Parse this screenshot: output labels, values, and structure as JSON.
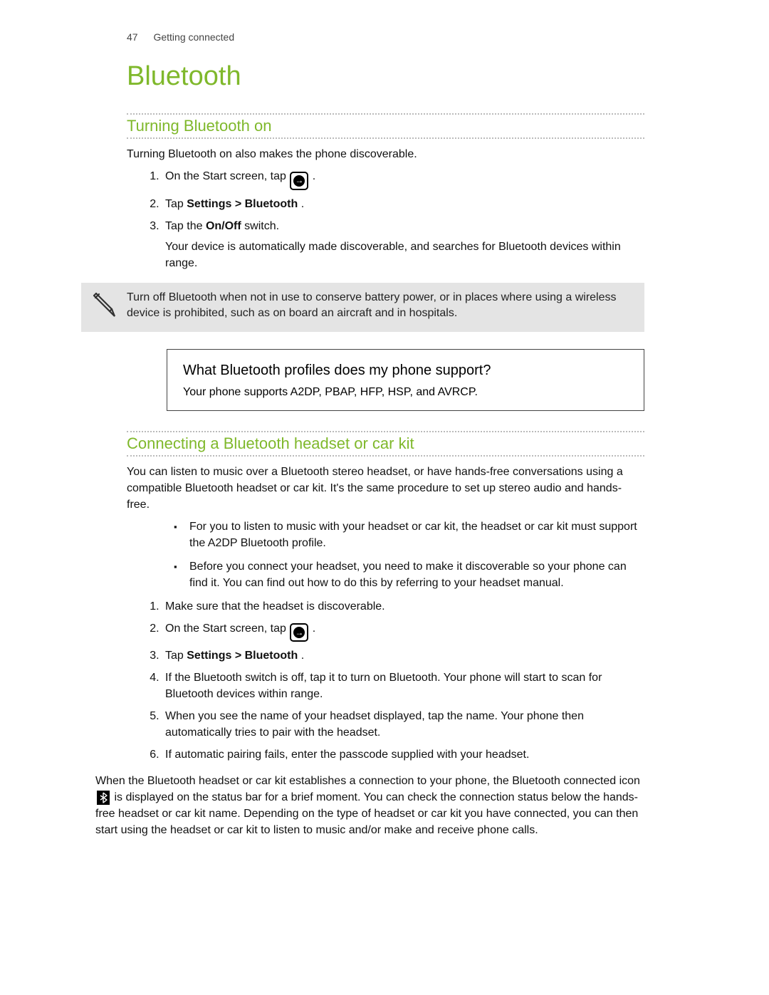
{
  "header": {
    "page_number": "47",
    "section": "Getting connected"
  },
  "title": "Bluetooth",
  "s1": {
    "heading": "Turning Bluetooth on",
    "intro": "Turning Bluetooth on also makes the phone discoverable.",
    "step1_pre": "On the Start screen, tap ",
    "step1_post": ".",
    "step2_pre": "Tap ",
    "step2_bold": "Settings > Bluetooth",
    "step2_post": ".",
    "step3_pre": "Tap the ",
    "step3_bold": "On/Off",
    "step3_post": " switch.",
    "step3_sub": "Your device is automatically made discoverable, and searches for Bluetooth devices within range."
  },
  "note": "Turn off Bluetooth when not in use to conserve battery power, or in places where using a wireless device is prohibited, such as on board an aircraft and in hospitals.",
  "qa": {
    "q": "What Bluetooth profiles does my phone support?",
    "a": "Your phone supports A2DP, PBAP, HFP, HSP, and AVRCP."
  },
  "s2": {
    "heading": "Connecting a Bluetooth headset or car kit",
    "intro": "You can listen to music over a Bluetooth stereo headset, or have hands-free conversations using a compatible Bluetooth headset or car kit. It's the same procedure to set up stereo audio and hands-free.",
    "b1": "For you to listen to music with your headset or car kit, the headset or car kit must support the A2DP Bluetooth profile.",
    "b2": "Before you connect your headset, you need to make it discoverable so your phone can find it. You can find out how to do this by referring to your headset manual.",
    "step1": "Make sure that the headset is discoverable.",
    "step2_pre": "On the Start screen, tap ",
    "step2_post": ".",
    "step3_pre": "Tap ",
    "step3_bold": "Settings > Bluetooth",
    "step3_post": ".",
    "step4": "If the Bluetooth switch is off, tap it to turn on Bluetooth. Your phone will start to scan for Bluetooth devices within range.",
    "step5": "When you see the name of your headset displayed, tap the name. Your phone then automatically tries to pair with the headset.",
    "step6": "If automatic pairing fails, enter the passcode supplied with your headset.",
    "outro_pre": "When the Bluetooth headset or car kit establishes a connection to your phone, the Bluetooth connected icon ",
    "outro_post": " is displayed on the status bar for a brief moment. You can check the connection status below the hands-free headset or car kit name. Depending on the type of headset or car kit you have connected, you can then start using the headset or car kit to listen to music and/or make and receive phone calls."
  }
}
